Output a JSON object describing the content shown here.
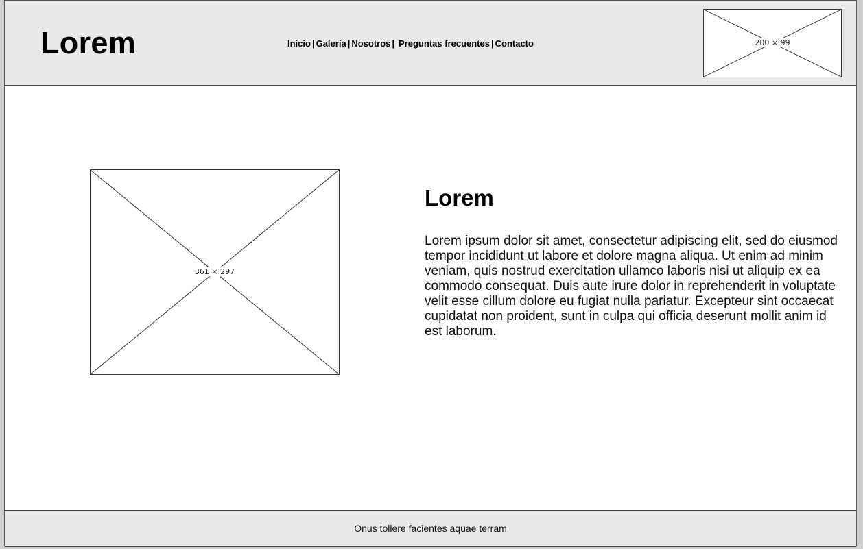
{
  "header": {
    "brand": "Lorem",
    "nav": {
      "items": [
        "Inicio",
        "Galería",
        "Nosotros",
        "Preguntas frecuentes",
        "Contacto"
      ],
      "separator": "|"
    },
    "logo_placeholder": {
      "label": "200 × 99",
      "icon": "image-placeholder-icon"
    }
  },
  "main": {
    "image_placeholder": {
      "label": "361 × 297",
      "icon": "image-placeholder-icon"
    },
    "title": "Lorem",
    "body": "Lorem ipsum dolor sit amet, consectetur adipiscing elit, sed do eiusmod tempor incididunt ut labore et dolore magna aliqua. Ut enim ad minim veniam, quis nostrud exercitation ullamco laboris nisi ut aliquip ex ea commodo consequat. Duis aute irure dolor in reprehenderit in voluptate velit esse cillum dolore eu fugiat nulla pariatur. Excepteur sint occaecat cupidatat non proident, sunt in culpa qui officia deserunt mollit anim id est laborum."
  },
  "footer": {
    "text": "Onus tollere facientes aquae terram"
  },
  "colors": {
    "header_bg": "#e9e9e9",
    "footer_bg": "#e9e9e9",
    "page_bg": "#ffffff",
    "border": "#444444"
  }
}
